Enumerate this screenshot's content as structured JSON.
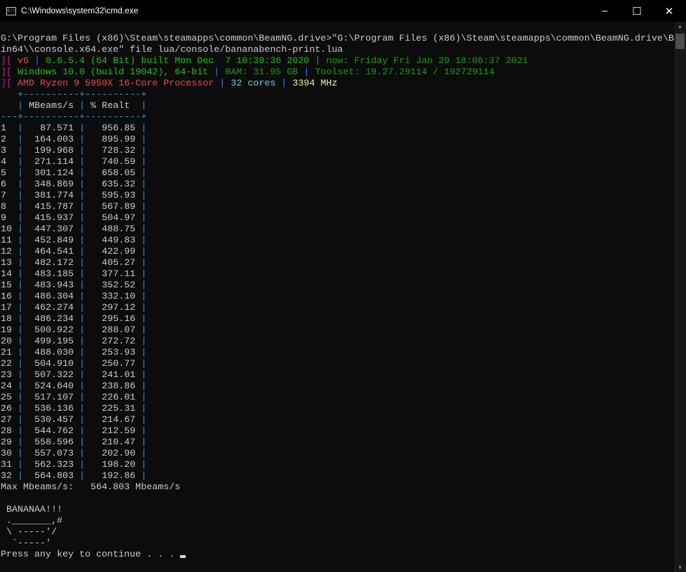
{
  "window": {
    "title": "C:\\Windows\\system32\\cmd.exe",
    "icon": "cmd-icon",
    "minimize": "–",
    "maximize": "☐",
    "close": "✕"
  },
  "colors": {
    "pink": "#c0208f",
    "red": "#e74856",
    "blue": "#3b78ff",
    "green": "#16c60c",
    "dark_green": "#13a10e",
    "cyan": "#61d6d6",
    "yellow": "#f9f1a5",
    "text": "#cccccc",
    "background": "#0c0c0c"
  },
  "console": {
    "command_lines": [
      "G:\\Program Files (x86)\\Steam\\steamapps\\common\\BeamNG.drive>\"G:\\Program Files (x86)\\Steam\\steamapps\\common\\BeamNG.drive\\B",
      "in64\\\\console.x64.exe\" file lua/console/bananabench-print.lua"
    ],
    "info_lines": [
      [
        {
          "t": "][ ",
          "c": "pink"
        },
        {
          "t": "v6",
          "c": "red"
        },
        {
          "t": " | ",
          "c": "blue"
        },
        {
          "t": "0.6.5.4 (64 Bit) built Mon Dec  7 10:39:36 2020",
          "c": "green"
        },
        {
          "t": " | ",
          "c": "blue"
        },
        {
          "t": "now: Friday Fri Jan 29 18:06:37 2021",
          "c": "dgreen"
        }
      ],
      [
        {
          "t": "][ ",
          "c": "pink"
        },
        {
          "t": "Windows 10.0 (build 19042), 64-bit",
          "c": "green"
        },
        {
          "t": " | ",
          "c": "blue"
        },
        {
          "t": "RAM: 31.95 GB",
          "c": "dgreen"
        },
        {
          "t": " | ",
          "c": "blue"
        },
        {
          "t": "Toolset: 19.27.29114 / 192729114",
          "c": "dgreen"
        }
      ],
      [
        {
          "t": "][ ",
          "c": "pink"
        },
        {
          "t": "AMD Ryzen 9 5950X 16-Core Processor",
          "c": "red"
        },
        {
          "t": " | ",
          "c": "blue"
        },
        {
          "t": "32 cores",
          "c": "cyan"
        },
        {
          "t": " | ",
          "c": "blue"
        },
        {
          "t": "3394 MHz",
          "c": "yellow"
        }
      ]
    ],
    "table": {
      "headers": [
        "MBeams/s",
        "% Realt"
      ],
      "rows": [
        [
          "1",
          "87.571",
          "956.85"
        ],
        [
          "2",
          "164.003",
          "895.99"
        ],
        [
          "3",
          "199.968",
          "728.32"
        ],
        [
          "4",
          "271.114",
          "740.59"
        ],
        [
          "5",
          "301.124",
          "658.05"
        ],
        [
          "6",
          "348.869",
          "635.32"
        ],
        [
          "7",
          "381.774",
          "595.93"
        ],
        [
          "8",
          "415.787",
          "567.89"
        ],
        [
          "9",
          "415.937",
          "504.97"
        ],
        [
          "10",
          "447.307",
          "488.75"
        ],
        [
          "11",
          "452.849",
          "449.83"
        ],
        [
          "12",
          "464.541",
          "422.99"
        ],
        [
          "13",
          "482.172",
          "405.27"
        ],
        [
          "14",
          "483.185",
          "377.11"
        ],
        [
          "15",
          "483.943",
          "352.52"
        ],
        [
          "16",
          "486.304",
          "332.10"
        ],
        [
          "17",
          "462.274",
          "297.12"
        ],
        [
          "18",
          "486.234",
          "295.16"
        ],
        [
          "19",
          "500.922",
          "288.07"
        ],
        [
          "20",
          "499.195",
          "272.72"
        ],
        [
          "21",
          "488.030",
          "253.93"
        ],
        [
          "22",
          "504.910",
          "250.77"
        ],
        [
          "23",
          "507.322",
          "241.01"
        ],
        [
          "24",
          "524.640",
          "238.86"
        ],
        [
          "25",
          "517.107",
          "226.01"
        ],
        [
          "26",
          "536.136",
          "225.31"
        ],
        [
          "27",
          "530.457",
          "214.67"
        ],
        [
          "28",
          "544.762",
          "212.59"
        ],
        [
          "29",
          "558.596",
          "210.47"
        ],
        [
          "30",
          "557.073",
          "202.90"
        ],
        [
          "31",
          "562.323",
          "198.20"
        ],
        [
          "32",
          "564.803",
          "192.86"
        ]
      ]
    },
    "max_line": "Max Mbeams/s:   564.803 Mbeams/s",
    "banana_lines": [
      " BANANAA!!!",
      " ._______,#",
      " \\ -----'/",
      "  `-----'"
    ],
    "prompt": "Press any key to continue . . . "
  }
}
